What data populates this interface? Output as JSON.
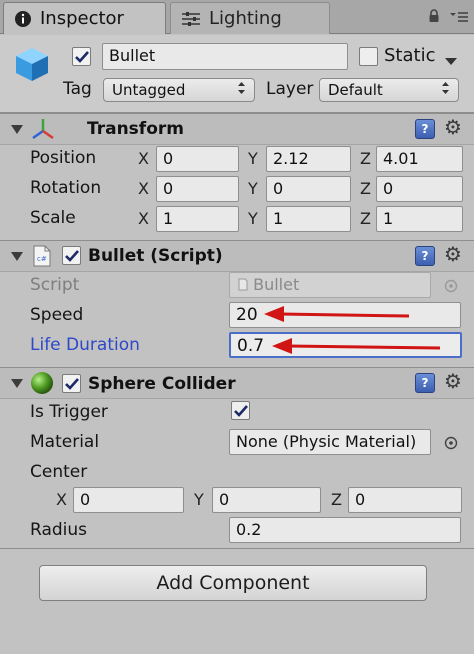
{
  "tabs": [
    {
      "label": "Inspector",
      "icon": "info-icon"
    },
    {
      "label": "Lighting",
      "icon": "lighting-sliders-icon"
    }
  ],
  "object": {
    "name": "Bullet",
    "active": true,
    "static_label": "Static",
    "tag_label": "Tag",
    "tag_value": "Untagged",
    "layer_label": "Layer",
    "layer_value": "Default"
  },
  "transform": {
    "title": "Transform",
    "position": {
      "label": "Position",
      "x": "0",
      "y": "2.12",
      "z": "4.01"
    },
    "rotation": {
      "label": "Rotation",
      "x": "0",
      "y": "0",
      "z": "0"
    },
    "scale": {
      "label": "Scale",
      "x": "1",
      "y": "1",
      "z": "1"
    },
    "axis": {
      "x": "X",
      "y": "Y",
      "z": "Z"
    }
  },
  "script": {
    "title": "Bullet (Script)",
    "script_label": "Script",
    "script_value": "Bullet",
    "speed_label": "Speed",
    "speed_value": "20",
    "life_label": "Life Duration",
    "life_value": "0.7"
  },
  "collider": {
    "title": "Sphere Collider",
    "trigger_label": "Is Trigger",
    "is_trigger": true,
    "material_label": "Material",
    "material_value": "None (Physic Material)",
    "center_label": "Center",
    "center": {
      "x": "0",
      "y": "0",
      "z": "0"
    },
    "radius_label": "Radius",
    "radius_value": "0.2"
  },
  "add_component": "Add Component",
  "colors": {
    "annotation_arrow": "#d11414",
    "focus_blue": "#4a6fc8",
    "label_blue": "#2d48c8"
  }
}
